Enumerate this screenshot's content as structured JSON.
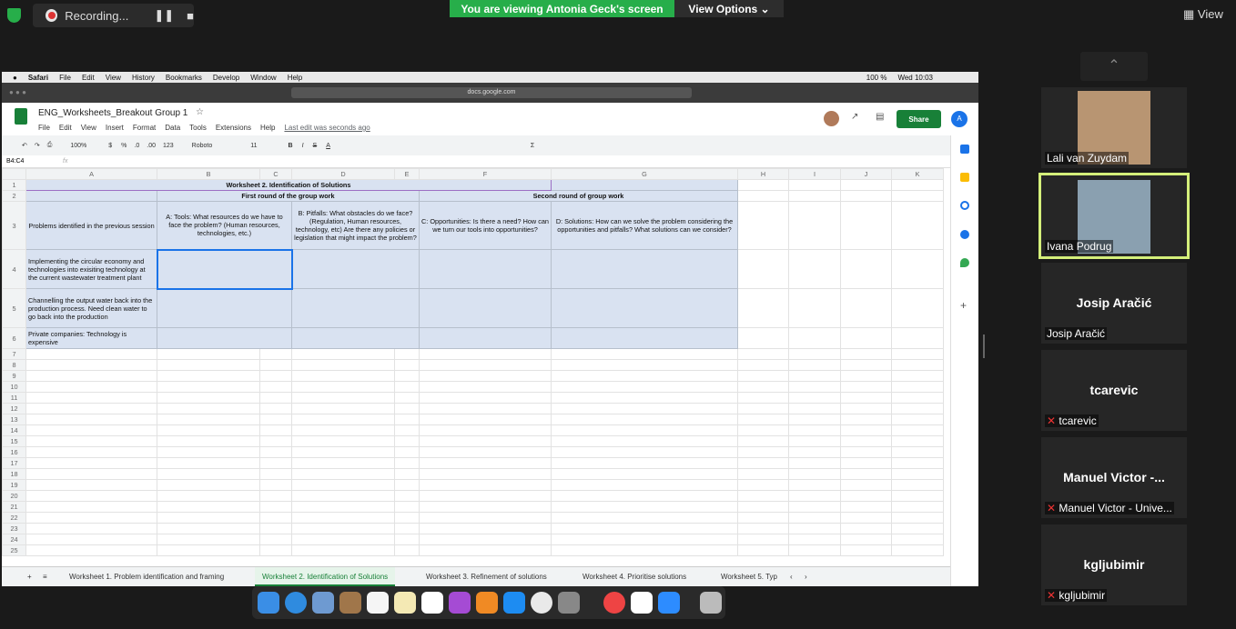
{
  "zoom": {
    "recording": "Recording...",
    "viewing": "You are viewing Antonia Geck's screen",
    "view_options": "View Options",
    "view": "View"
  },
  "mac": {
    "menu": [
      "Safari",
      "File",
      "Edit",
      "View",
      "History",
      "Bookmarks",
      "Develop",
      "Window",
      "Help"
    ],
    "clock": "Wed 10:03",
    "battery": "100 %",
    "url": "docs.google.com"
  },
  "doc": {
    "title": "ENG_Worksheets_Breakout Group 1",
    "menu": [
      "File",
      "Edit",
      "View",
      "Insert",
      "Format",
      "Data",
      "Tools",
      "Extensions",
      "Help"
    ],
    "last_edit": "Last edit was seconds ago",
    "share": "Share",
    "avatar": "A"
  },
  "toolbar": {
    "zoom": "100%",
    "font": "Roboto",
    "size": "11",
    "currency": "$",
    "percent": "%",
    "dec0": ".0",
    "dec00": ".00",
    "fmt": "123"
  },
  "formula": {
    "ref": "B4:C4",
    "fx": "fx"
  },
  "columns": [
    "A",
    "B",
    "C",
    "D",
    "E",
    "F",
    "G",
    "H",
    "I",
    "J",
    "K"
  ],
  "sheet": {
    "title": "Worksheet 2. Identification of Solutions",
    "first": "First round of the group work",
    "second": "Second round of group work",
    "h_a": "Problems identified in the previous session",
    "h_b": "A: Tools: What resources do we have to face the problem? (Human resources, technologies, etc.)",
    "h_d": "B: Pitfalls: What obstacles do we face? (Regulation, Human resources, technology, etc) Are there any policies or legislation that might impact the problem?",
    "h_f": "C: Opportunities: Is there a need? How can we turn our tools into opportunities?",
    "h_g": "D: Solutions: How can we solve the problem considering the opportunities and pitfalls? What solutions can we consider?",
    "r4": "Implementing the circular economy and technologies into exisiting technology at the current wastewater treatment plant",
    "r5": "Channelling the output water back into the production process. Need clean water to go back into the production",
    "r6": "Private companies: Technology is expensive"
  },
  "tabs": [
    "Worksheet 1. Problem identification and framing",
    "Worksheet 2. Identification of Solutions",
    "Worksheet 3. Refinement of solutions",
    "Worksheet 4. Prioritise solutions",
    "Worksheet 5. Typ"
  ],
  "participants": [
    {
      "name": "Lali van Zuydam"
    },
    {
      "name": "Ivana Podrug"
    },
    {
      "big": "Josip Aračić",
      "name": "Josip Aračić"
    },
    {
      "big": "tcarevic",
      "name": "tcarevic"
    },
    {
      "big": "Manuel Victor -...",
      "name": "Manuel Victor - Unive..."
    },
    {
      "big": "kgljubimir",
      "name": "kgljubimir"
    }
  ]
}
